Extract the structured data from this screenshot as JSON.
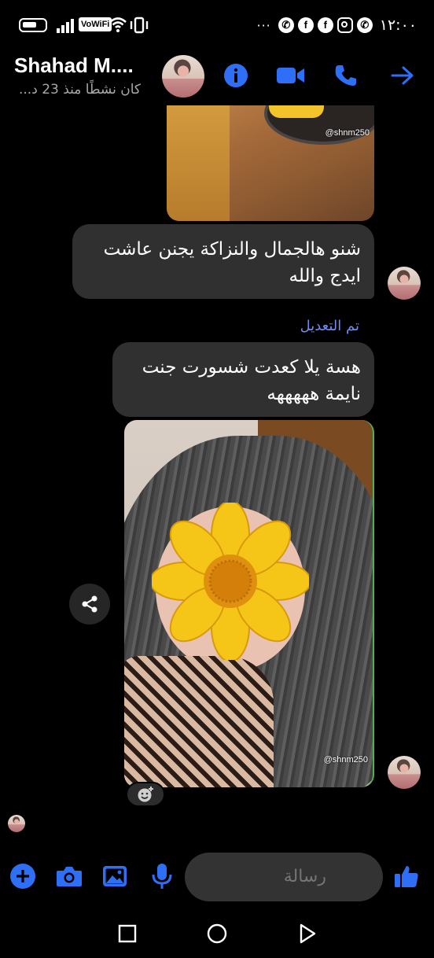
{
  "status_bar": {
    "vowifi": "VoWiFi",
    "dots": "···",
    "clock": "١٢:٠٠",
    "notification_icons": [
      "whatsapp-icon",
      "facebook-icon",
      "facebook-icon",
      "instagram-icon",
      "whatsapp-icon"
    ]
  },
  "header": {
    "contact_name": "Shahad M....",
    "last_active": "كان نشطًا منذ 23 د...",
    "actions": [
      "info-icon",
      "video-call-icon",
      "phone-call-icon",
      "forward-arrow-icon"
    ]
  },
  "messages": [
    {
      "type": "image",
      "watermark": "@shnm250"
    },
    {
      "type": "text",
      "text": "شنو هالجمال والنزاكة يجنن عاشت ايدج والله"
    },
    {
      "type": "edited_label",
      "text": "تم التعديل"
    },
    {
      "type": "text",
      "text": "هسة يلا كعدت شسورت جنت نايمة هههههه"
    },
    {
      "type": "image",
      "watermark": "@shnm250"
    }
  ],
  "composer": {
    "placeholder": "رسالة",
    "buttons": [
      "plus-icon",
      "camera-icon",
      "gallery-icon",
      "microphone-icon",
      "thumbs-up-icon"
    ]
  },
  "colors": {
    "accent": "#2f6ff5",
    "bubble": "#303030",
    "edited": "#6e8cf5",
    "background": "#000000"
  }
}
